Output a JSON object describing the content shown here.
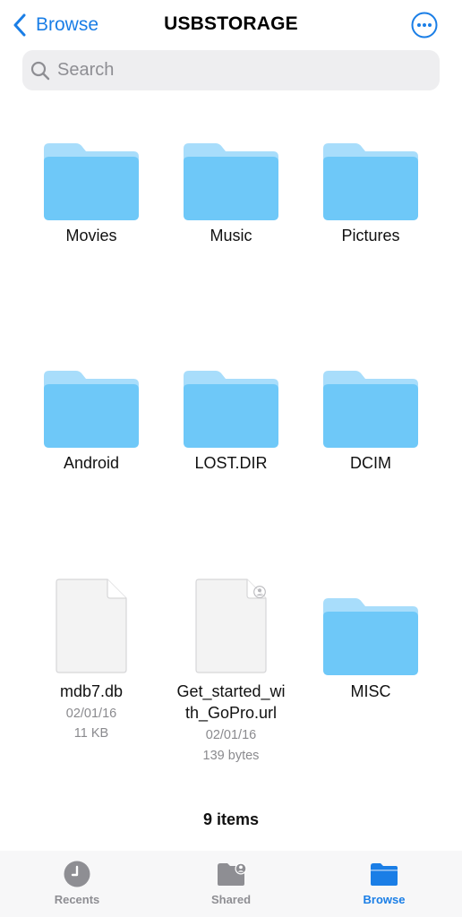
{
  "nav": {
    "back_label": "Browse",
    "title": "USBSTORAGE",
    "more_icon": "ellipsis-circle-icon"
  },
  "search": {
    "placeholder": "Search"
  },
  "items": [
    {
      "name": "Movies",
      "kind": "folder"
    },
    {
      "name": "Music",
      "kind": "folder"
    },
    {
      "name": "Pictures",
      "kind": "folder"
    },
    {
      "name": "Android",
      "kind": "folder"
    },
    {
      "name": "LOST.DIR",
      "kind": "folder"
    },
    {
      "name": "DCIM",
      "kind": "folder"
    },
    {
      "name": "mdb7.db",
      "kind": "file",
      "date": "02/01/16",
      "size": "11 KB"
    },
    {
      "name_line1": "Get_started_wi",
      "name_line2": "th_GoPro.url",
      "kind": "file",
      "date": "02/01/16",
      "size": "139 bytes"
    },
    {
      "name": "MISC",
      "kind": "folder"
    }
  ],
  "footer": {
    "count": "9 items"
  },
  "tabbar": {
    "tabs": [
      {
        "label": "Recents",
        "icon": "clock-icon",
        "active": false
      },
      {
        "label": "Shared",
        "icon": "shared-folder-icon",
        "active": false
      },
      {
        "label": "Browse",
        "icon": "folder-icon",
        "active": true
      }
    ]
  },
  "colors": {
    "accent": "#1a7ee6",
    "folder": "#6ec8f8",
    "folder_light": "#a8ddfb",
    "tab_inactive": "#8e8e93"
  }
}
